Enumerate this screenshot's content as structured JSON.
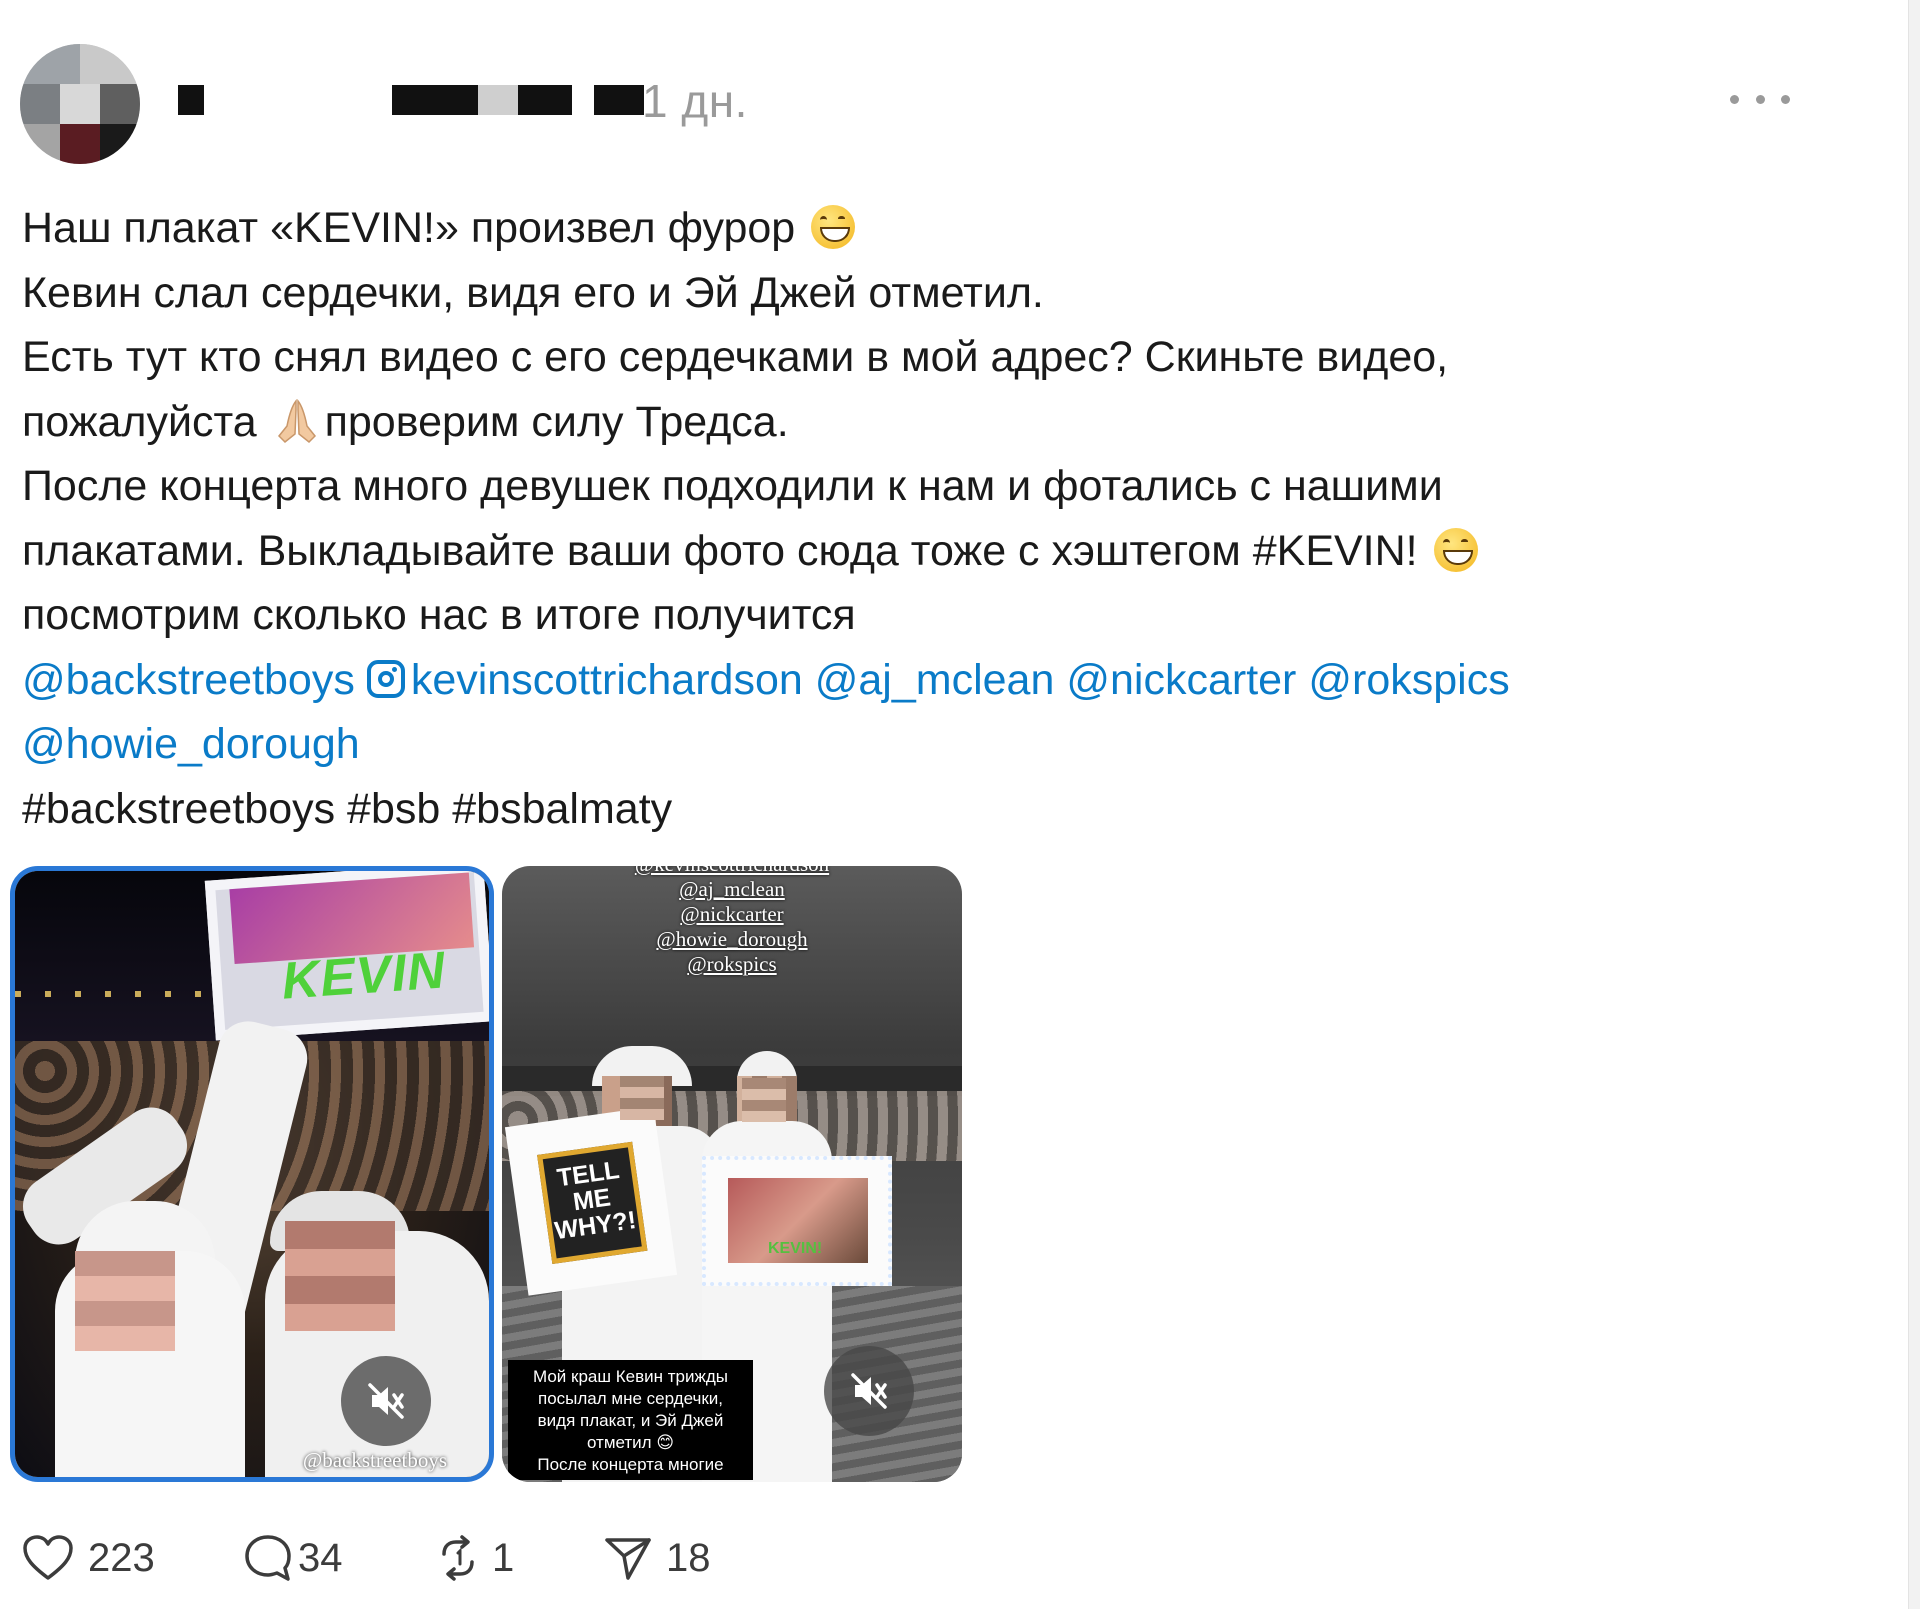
{
  "post": {
    "timestamp": "1 дн.",
    "body_lines": [
      "Наш плакат «KEVIN!» произвел фурор",
      "Кевин слал сердечки, видя его и Эй Джей отметил.",
      "Есть тут кто снял видео с его сердечками в мой адрес? Скиньте видео,",
      "пожалуйста",
      "проверим силу Тредса.",
      "После концерта много девушек подходили к нам и фотались с нашими",
      "плакатами. Выкладывайте ваши фото сюда тоже с хэштегом #KEVIN!",
      "посмотрим сколько нас в итоге получится"
    ],
    "mentions": [
      "@backstreetboys",
      "kevinscottrichardson",
      "@aj_mclean",
      "@nickcarter",
      "@rokspics",
      "@howie_dorough"
    ],
    "hashtags_line": "#backstreetboys #bsb #bsbalmaty"
  },
  "media": [
    {
      "kind": "video",
      "sign_text": "KEVIN",
      "credit": "@backstreetboys"
    },
    {
      "kind": "video",
      "overlay_tags": [
        "@kevinscottrichardson",
        "@aj_mclean",
        "@nickcarter",
        "@howie_dorough",
        "@rokspics"
      ],
      "poster_text": [
        "TELL",
        "ME",
        "WHY?!"
      ],
      "sign_text": "KEVIN!",
      "caption_lines": [
        "Мой краш Кевин трижды",
        "посылал мне сердечки,",
        "видя плакат, и Эй Джей",
        "отметил 😊",
        "После концерта многие"
      ]
    }
  ],
  "actions": {
    "likes": "223",
    "replies": "34",
    "reposts": "1",
    "shares": "18"
  },
  "colors": {
    "link": "#0a7bc8",
    "muted": "#9a9a9a",
    "selected_border": "#2a78d6"
  },
  "icons": [
    "more-icon",
    "instagram-icon",
    "grin-emoji",
    "pray-emoji",
    "mute-icon",
    "heart-icon",
    "comment-icon",
    "repost-icon",
    "send-icon"
  ]
}
